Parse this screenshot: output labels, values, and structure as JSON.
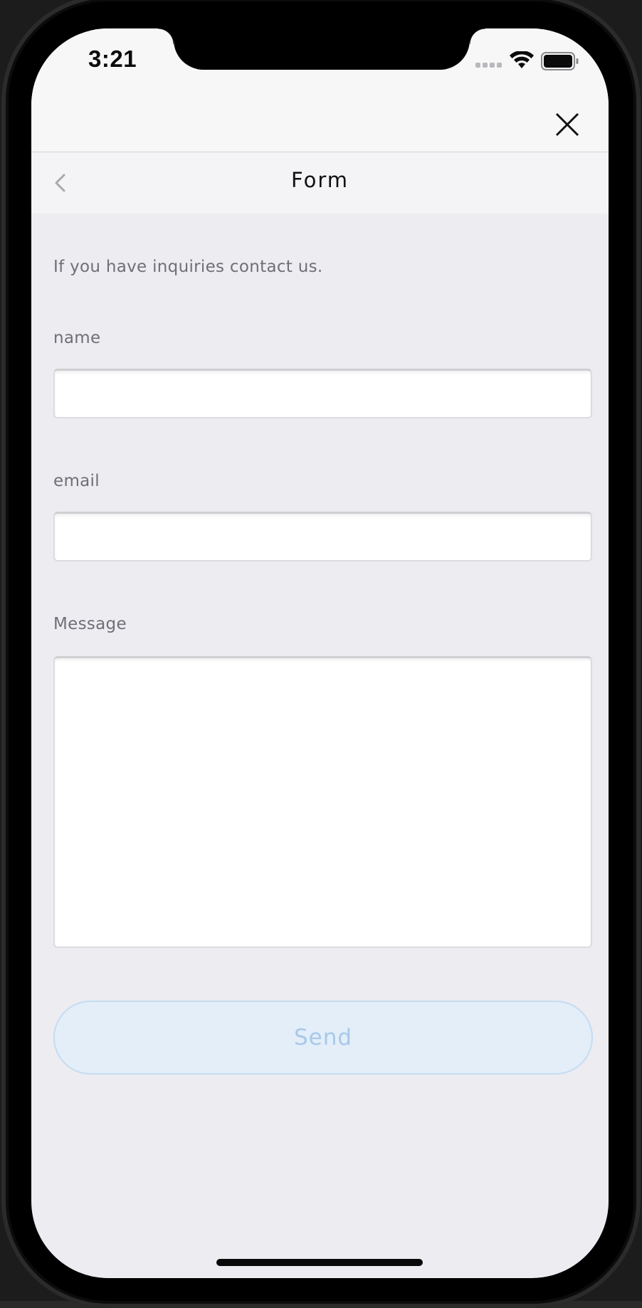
{
  "status_bar": {
    "time": "3:21",
    "icons": [
      "signal-icon",
      "wifi-icon",
      "battery-icon"
    ]
  },
  "modal": {
    "close_icon": "close-icon"
  },
  "nav": {
    "title": "Form",
    "back_icon": "chevron-left-icon"
  },
  "form": {
    "intro": "If you have inquiries contact us.",
    "name_label": "name",
    "name_value": "",
    "email_label": "email",
    "email_value": "",
    "message_label": "Message",
    "message_value": "",
    "send_label": "Send"
  },
  "colors": {
    "background": "#edecf1",
    "send_button_bg": "#e3eef9",
    "send_button_text": "#a8c9e9"
  }
}
